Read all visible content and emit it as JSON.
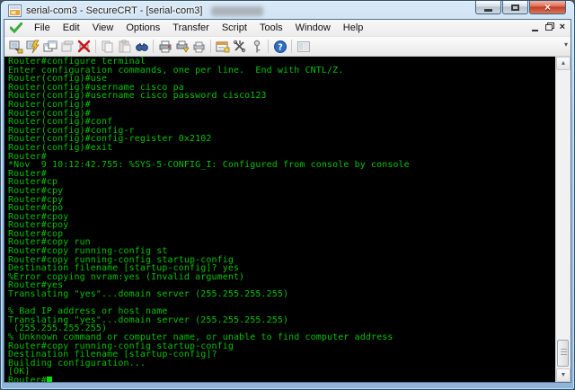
{
  "window": {
    "title": "serial-com3 - SecureCRT - [serial-com3]",
    "controls": {
      "minimize": "minimize",
      "maximize": "maximize",
      "close": "close"
    }
  },
  "menu": {
    "items": [
      "File",
      "Edit",
      "View",
      "Options",
      "Transfer",
      "Script",
      "Tools",
      "Window",
      "Help"
    ]
  },
  "toolbar": {
    "icons": [
      "connect-icon",
      "quick-connect-icon",
      "session-tabs-icon",
      "clone-session-icon",
      "disconnect-icon",
      "copy-icon",
      "paste-icon",
      "find-icon",
      "print-icon",
      "print-setup-icon",
      "print-preview-icon",
      "properties-icon",
      "script-icon",
      "key-icon",
      "help-icon",
      "session-manager-icon"
    ]
  },
  "terminal": {
    "background": "#000000",
    "text_color": "#00c300",
    "cursor_color": "#00dd00",
    "lines": [
      "Router#configure terminal",
      "Enter configuration commands, one per line.  End with CNTL/Z.",
      "Router(config)#use",
      "Router(config)#username cisco pa",
      "Router(config)#username cisco password cisco123",
      "Router(config)#",
      "Router(config)#",
      "Router(config)#conf",
      "Router(config)#config-r",
      "Router(config)#config-register 0x2102",
      "Router(config)#exit",
      "Router#",
      "*Nov  9 10:12:42.755: %SYS-5-CONFIG_I: Configured from console by console",
      "Router#",
      "Router#cp",
      "Router#cpy",
      "Router#cpy",
      "Router#cpo",
      "Router#cpoy",
      "Router#cpoy",
      "Router#cop",
      "Router#copy run",
      "Router#copy running-config st",
      "Router#copy running-config startup-config",
      "Destination filename [startup-config]? yes",
      "%Error copying nvram:yes (Invalid argument)",
      "Router#yes",
      "Translating \"yes\"...domain server (255.255.255.255)",
      "",
      "% Bad IP address or host name",
      "Translating \"yes\"...domain server (255.255.255.255)",
      " (255.255.255.255)",
      "% Unknown command or computer name, or unable to find computer address",
      "Router#copy running-config startup-config",
      "Destination filename [startup-config]?",
      "Building configuration...",
      "[OK]",
      "Router#"
    ]
  }
}
